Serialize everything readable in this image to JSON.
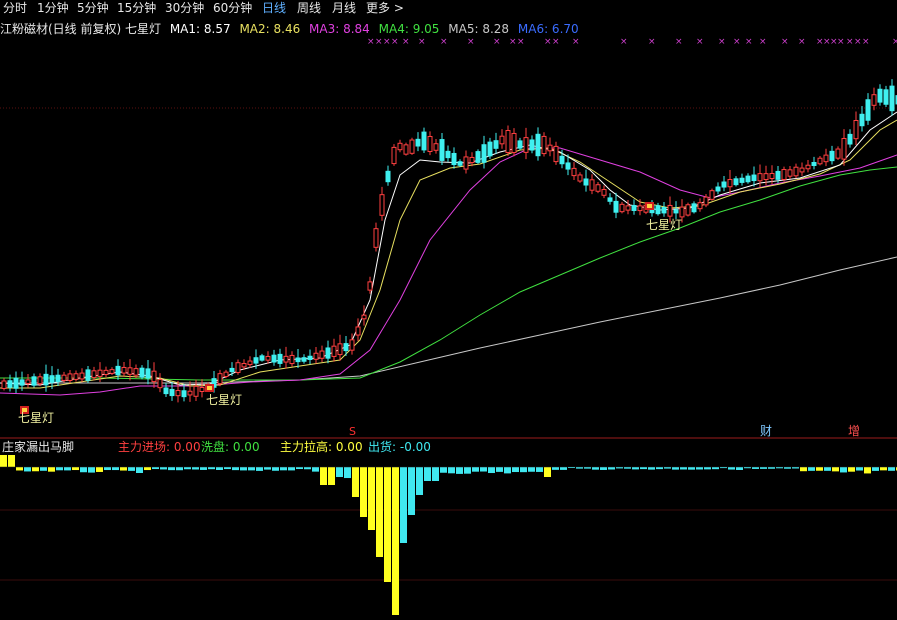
{
  "toolbar": {
    "periods": [
      {
        "label": "分时",
        "active": false
      },
      {
        "label": "1分钟",
        "active": false
      },
      {
        "label": "5分钟",
        "active": false
      },
      {
        "label": "15分钟",
        "active": false
      },
      {
        "label": "30分钟",
        "active": false
      },
      {
        "label": "60分钟",
        "active": false
      },
      {
        "label": "日线",
        "active": true
      },
      {
        "label": "周线",
        "active": false
      },
      {
        "label": "月线",
        "active": false
      },
      {
        "label": "更多 >",
        "active": false
      }
    ]
  },
  "infobar": {
    "title": "江粉磁材(日线 前复权) 七星灯",
    "ma1": "MA1: 8.57",
    "ma2": "MA2: 8.46",
    "ma3": "MA3: 8.84",
    "ma4": "MA4: 9.05",
    "ma5": "MA5: 8.28",
    "ma6": "MA6: 6.70"
  },
  "annotations": {
    "seven_star_1": "七星灯",
    "seven_star_2": "七星灯",
    "seven_star_3": "七星灯",
    "marker_s": "S",
    "marker_cai": "财",
    "marker_zeng": "增"
  },
  "indicator": {
    "title": "庄家漏出马脚",
    "main_entry": "主力进场: 0.00",
    "wash": "洗盘: 0.00",
    "pull_up": "主力拉高: 0.00",
    "shipping": "出货: -0.00"
  },
  "colors": {
    "up": "#ff4040",
    "down": "#3ff0f0",
    "ma1": "#ffffff",
    "ma2": "#e8e060",
    "ma3": "#e040e0",
    "ma4": "#40e040",
    "ma5": "#c8c8c8",
    "ma6": "#3a6cff",
    "divider": "#9b1c1c",
    "x_marker": "#d040d0",
    "bar_yellow": "#ffff20",
    "bar_cyan": "#40e8f0"
  }
}
